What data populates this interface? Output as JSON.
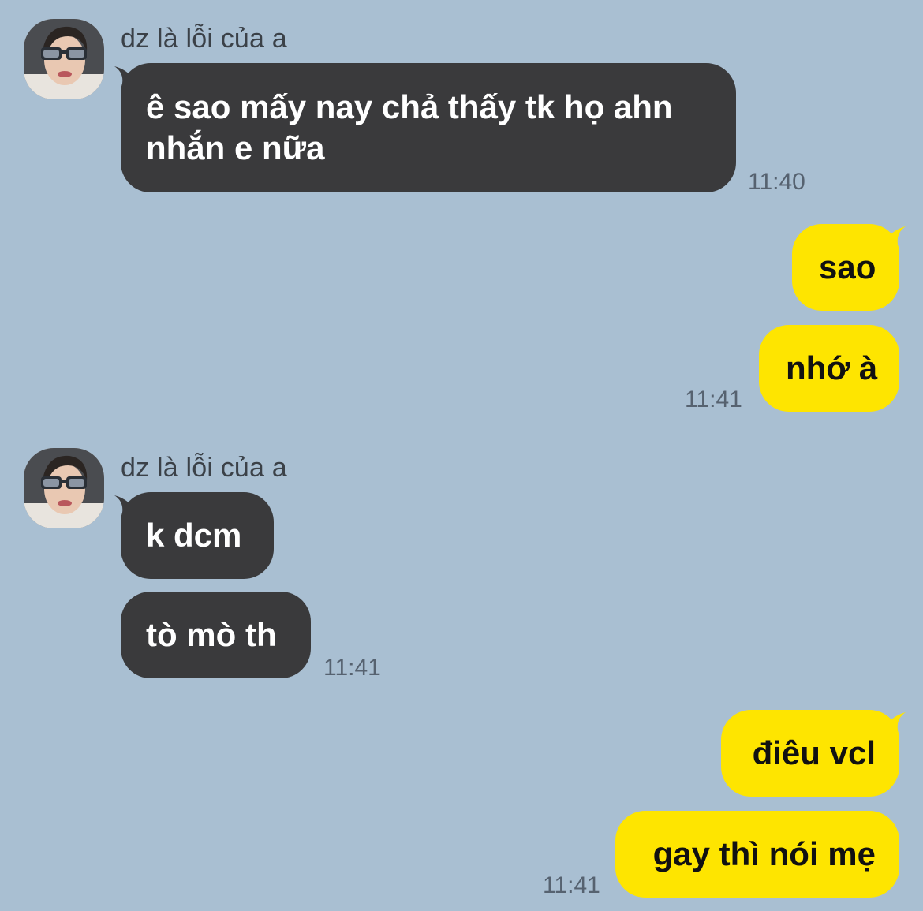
{
  "conversation": {
    "groups": [
      {
        "sender": "dz là lỗi của a",
        "messages": [
          {
            "line1": "ê sao mấy nay chả thấy tk họ ahn",
            "line2": "nhắn e nữa"
          }
        ],
        "time": "11:40"
      },
      {
        "sender": "me",
        "messages": [
          "sao",
          "nhớ à"
        ],
        "time": "11:41"
      },
      {
        "sender": "dz là lỗi của a",
        "messages": [
          "k dcm",
          "tò mò th"
        ],
        "time": "11:41"
      },
      {
        "sender": "me",
        "messages": [
          "điêu vcl",
          "gay thì nói mẹ"
        ],
        "time": "11:41"
      }
    ]
  },
  "colors": {
    "background": "#a9bfd2",
    "incoming_bubble": "#3a3a3c",
    "outgoing_bubble": "#fee500"
  },
  "icons": {
    "avatar": "profile-photo"
  }
}
